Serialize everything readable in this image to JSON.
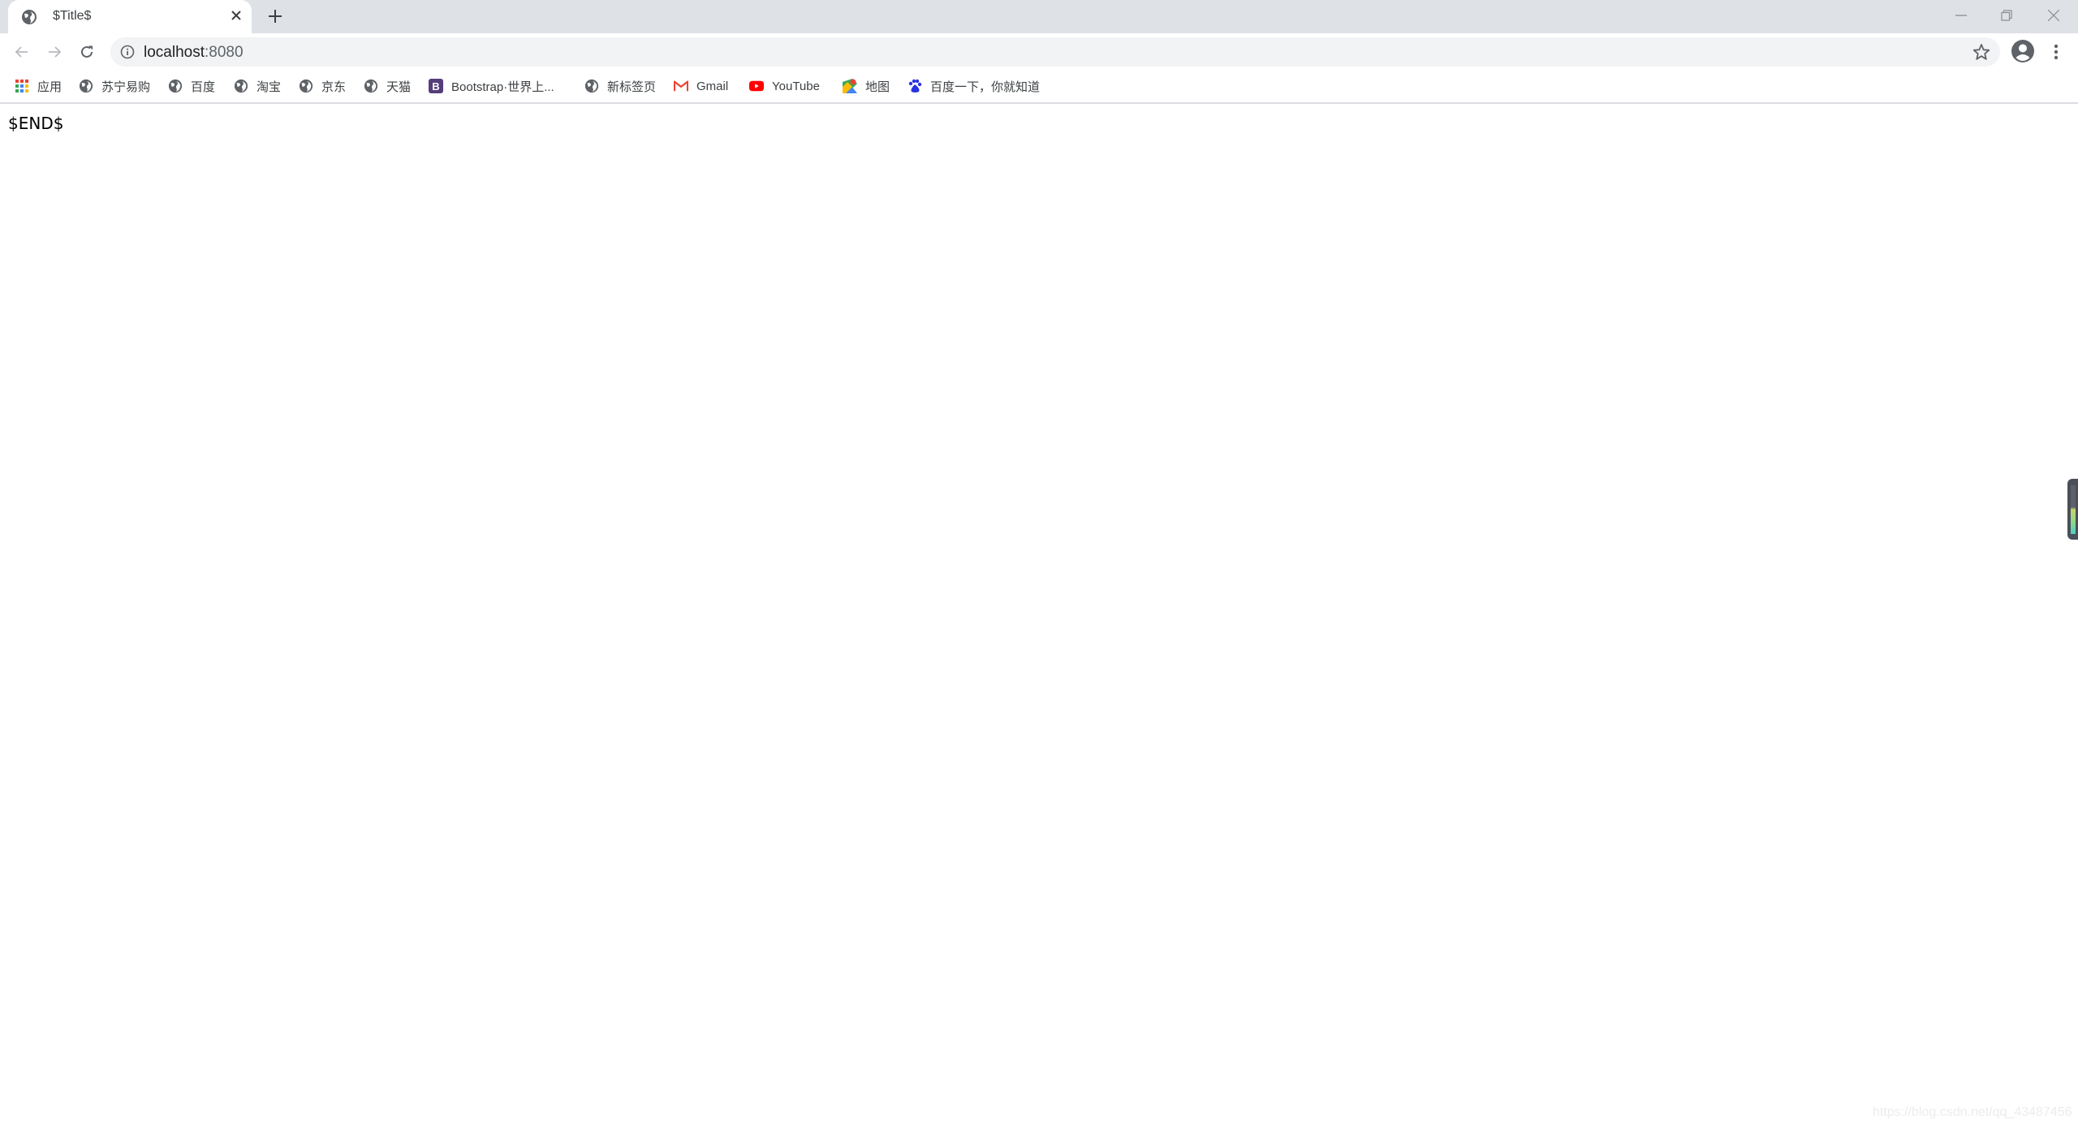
{
  "tab": {
    "title": "$Title$",
    "favicon": "globe-icon",
    "close_icon": "close-icon"
  },
  "new_tab": {
    "label": "+"
  },
  "window_controls": {
    "minimize": "minimize-icon",
    "restore": "restore-icon",
    "close": "close-icon"
  },
  "toolbar": {
    "back": "back-arrow-icon",
    "forward": "forward-arrow-icon",
    "reload": "reload-icon",
    "site_info": "info-icon",
    "url_host": "localhost",
    "url_port": ":8080",
    "bookmark_star": "star-icon",
    "profile": "profile-icon",
    "menu": "more-vert-icon"
  },
  "bookmarks": [
    {
      "label": "应用",
      "icon": "apps-grid-icon"
    },
    {
      "label": "苏宁易购",
      "icon": "globe-icon"
    },
    {
      "label": "百度",
      "icon": "globe-icon"
    },
    {
      "label": "淘宝",
      "icon": "globe-icon"
    },
    {
      "label": "京东",
      "icon": "globe-icon"
    },
    {
      "label": "天猫",
      "icon": "globe-icon"
    },
    {
      "label": "Bootstrap·世界上...",
      "icon": "bootstrap-icon"
    },
    {
      "label": "新标签页",
      "icon": "globe-icon"
    },
    {
      "label": "Gmail",
      "icon": "gmail-icon"
    },
    {
      "label": "YouTube",
      "icon": "youtube-icon"
    },
    {
      "label": "地图",
      "icon": "maps-icon"
    },
    {
      "label": "百度一下，你就知道",
      "icon": "baidu-paw-icon"
    }
  ],
  "page": {
    "body_text": "$END$"
  },
  "watermark": "https://blog.csdn.net/qq_43487456"
}
